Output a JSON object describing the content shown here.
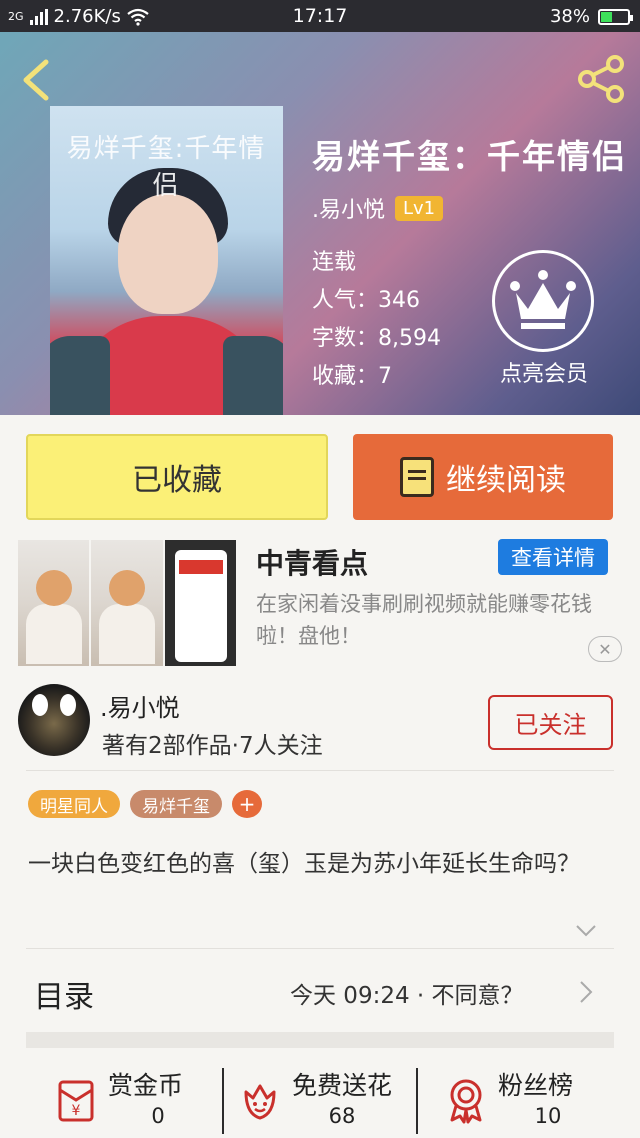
{
  "status_bar": {
    "network": "2G",
    "speed": "2.76K/s",
    "time": "17:17",
    "battery": "38%",
    "battery_level": 0.38
  },
  "book": {
    "cover_text": "易烊千玺:千年情侣",
    "title": "易烊千玺：千年情侣",
    "author": ".易小悦",
    "level": "Lv1",
    "status": "连载",
    "popularity": "人气：346",
    "word_count": "字数：8,594",
    "favorites": "收藏：7"
  },
  "vip": {
    "label": "点亮会员"
  },
  "actions": {
    "favorited": "已收藏",
    "continue": "继续阅读"
  },
  "ad": {
    "title": "中青看点",
    "detail_button": "查看详情",
    "description": "在家闲着没事刷刷视频就能赚零花钱啦！盘他！",
    "close": "✕"
  },
  "author_card": {
    "name": ".易小悦",
    "meta": "著有2部作品·7人关注",
    "follow_button": "已关注"
  },
  "tags": [
    "明星同人",
    "易烊千玺"
  ],
  "tag_add": "+",
  "summary": "一块白色变红色的喜（玺）玉是为苏小年延长生命吗？",
  "catalog": {
    "label": "目录",
    "update": "今天 09:24 · 不同意？"
  },
  "stats": [
    {
      "label": "赏金币",
      "value": "0"
    },
    {
      "label": "免费送花",
      "value": "68"
    },
    {
      "label": "粉丝榜",
      "value": "10"
    }
  ],
  "colors": {
    "accent_orange": "#e66a3a",
    "fav_yellow": "#fbf077",
    "follow_red": "#c9302c",
    "ad_blue": "#1e7ce0",
    "level_gold": "#f1b532"
  }
}
